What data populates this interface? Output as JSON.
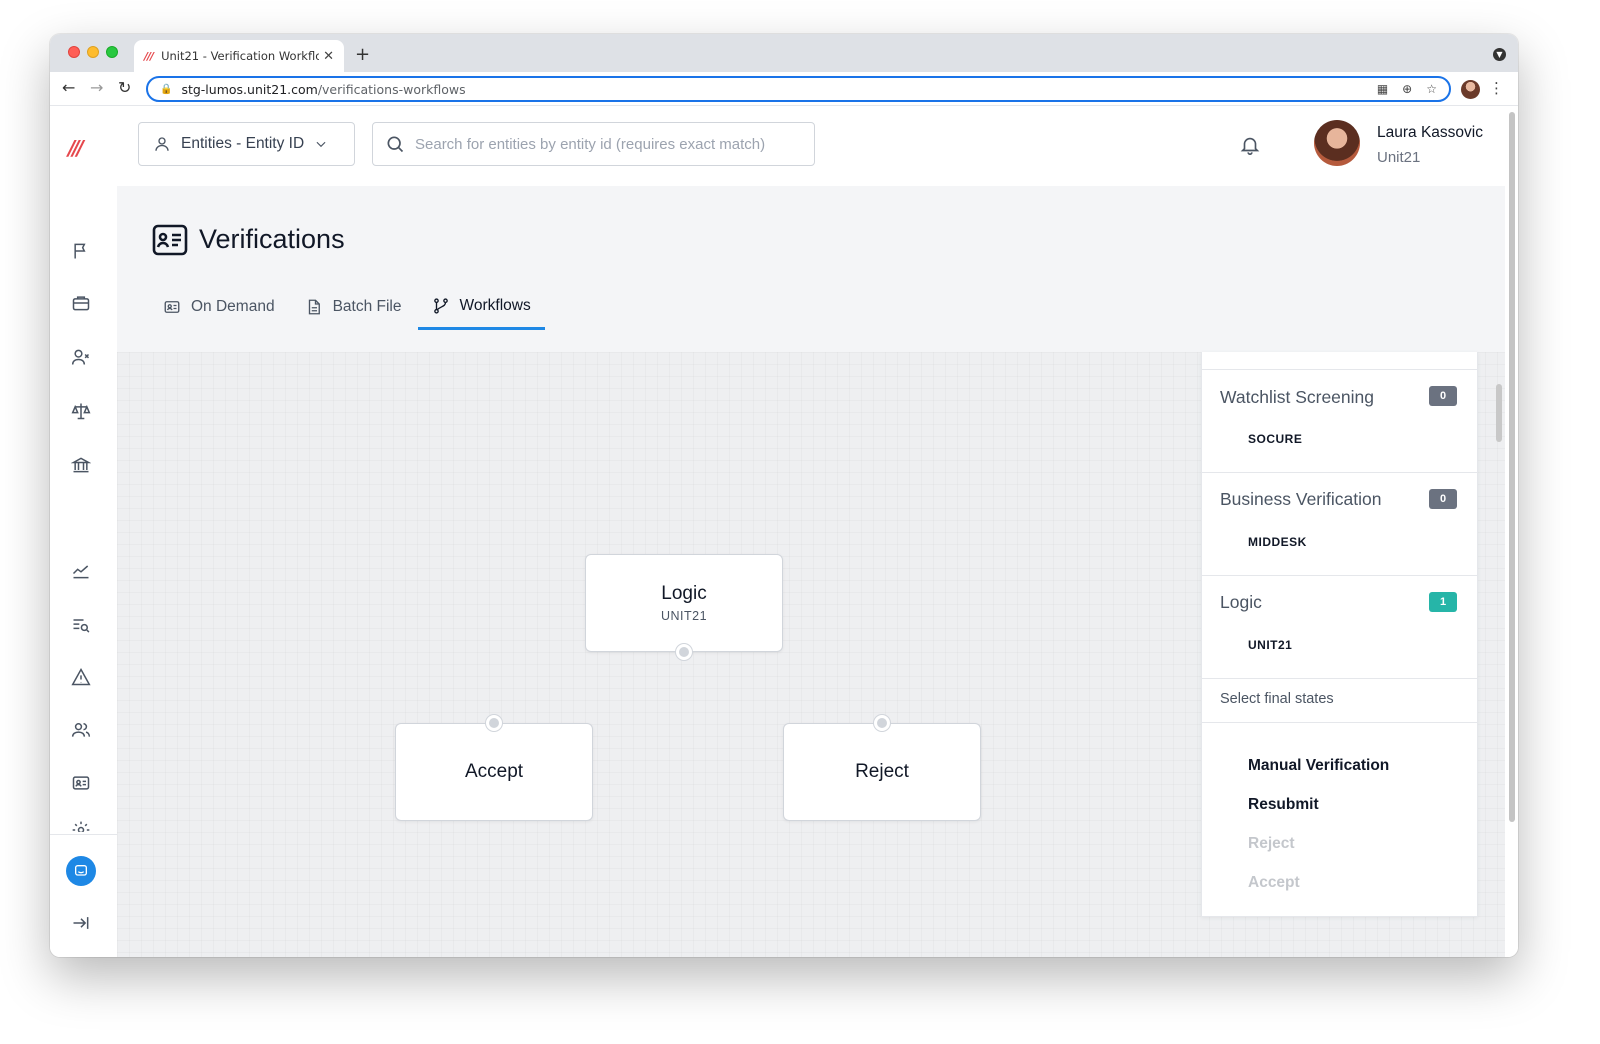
{
  "browser": {
    "tab_title": "Unit21 - Verification Workflows",
    "tab_favicon": "///",
    "url_host": "stg-lumos.unit21.com",
    "url_path": "/verifications-workflows"
  },
  "sidebar": {
    "logo": "///",
    "icons": [
      "flag-icon",
      "briefcase-icon",
      "user-x-icon",
      "scale-icon",
      "bank-icon",
      "chart-icon",
      "list-search-icon",
      "alert-icon",
      "users-icon",
      "id-card-icon",
      "settings-icon",
      "chat-icon",
      "collapse-icon"
    ]
  },
  "header": {
    "entity_select": "Entities - Entity ID",
    "search_placeholder": "Search for entities by entity id (requires exact match)",
    "user_name": "Laura Kassovic",
    "user_org": "Unit21"
  },
  "page": {
    "title": "Verifications",
    "tabs": [
      {
        "label": "On Demand",
        "active": false
      },
      {
        "label": "Batch File",
        "active": false
      },
      {
        "label": "Workflows",
        "active": true
      }
    ]
  },
  "canvas": {
    "nodes": {
      "logic": {
        "title": "Logic",
        "subtitle": "UNIT21"
      },
      "accept": {
        "title": "Accept"
      },
      "reject": {
        "title": "Reject"
      }
    }
  },
  "panel": {
    "sections": [
      {
        "label": "Watchlist Screening",
        "count": "0",
        "vendor": "SOCURE",
        "badge_color": "#6b7280"
      },
      {
        "label": "Business Verification",
        "count": "0",
        "vendor": "MIDDESK",
        "badge_color": "#6b7280"
      },
      {
        "label": "Logic",
        "count": "1",
        "vendor": "UNIT21",
        "badge_color": "#26b5a8"
      }
    ],
    "final_states_label": "Select final states",
    "final_states": [
      {
        "label": "Manual Verification",
        "enabled": true
      },
      {
        "label": "Resubmit",
        "enabled": true
      },
      {
        "label": "Reject",
        "enabled": false
      },
      {
        "label": "Accept",
        "enabled": false
      }
    ]
  },
  "colors": {
    "accent": "#1e88e5",
    "brand": "#e5484d",
    "teal_badge": "#26b5a8",
    "gray_badge": "#6b7280"
  }
}
